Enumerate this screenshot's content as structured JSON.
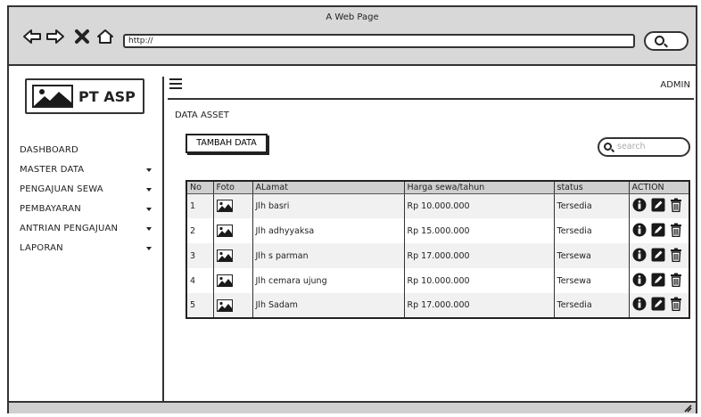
{
  "window": {
    "title": "A Web Page"
  },
  "browser": {
    "url": "http://"
  },
  "brand": {
    "name": "PT ASP"
  },
  "sidebar": {
    "items": [
      {
        "label": "DASHBOARD",
        "caret": false
      },
      {
        "label": "MASTER DATA",
        "caret": true
      },
      {
        "label": "PENGAJUAN SEWA",
        "caret": true
      },
      {
        "label": "PEMBAYARAN",
        "caret": true
      },
      {
        "label": "ANTRIAN PENGAJUAN",
        "caret": true
      },
      {
        "label": "LAPORAN",
        "caret": true
      }
    ]
  },
  "header": {
    "user": "ADMIN"
  },
  "main": {
    "title": "DATA ASSET",
    "add_label": "TAMBAH DATA",
    "search_placeholder": "search"
  },
  "table": {
    "columns": [
      "No",
      "Foto",
      "ALamat",
      "Harga sewa/tahun",
      "status",
      "ACTION"
    ],
    "rows": [
      {
        "no": "1",
        "alamat": "Jlh basri",
        "harga": "Rp 10.000.000",
        "status": "Tersedia"
      },
      {
        "no": "2",
        "alamat": "Jlh adhyyaksa",
        "harga": "Rp 15.000.000",
        "status": "Tersedia"
      },
      {
        "no": "3",
        "alamat": "Jlh s parman",
        "harga": "Rp 17.000.000",
        "status": "Tersewa"
      },
      {
        "no": "4",
        "alamat": "Jlh cemara ujung",
        "harga": "Rp 10.000.000",
        "status": "Tersewa"
      },
      {
        "no": "5",
        "alamat": "Jlh Sadam",
        "harga": "Rp 17.000.000",
        "status": "Tersedia"
      }
    ]
  },
  "icons": {
    "back": "arrow-left-icon",
    "forward": "arrow-right-icon",
    "stop": "close-icon",
    "home": "home-icon",
    "search": "search-icon",
    "menu": "hamburger-menu-icon",
    "photo": "image-icon",
    "info": "info-icon",
    "edit": "pencil-icon",
    "delete": "trash-icon"
  }
}
